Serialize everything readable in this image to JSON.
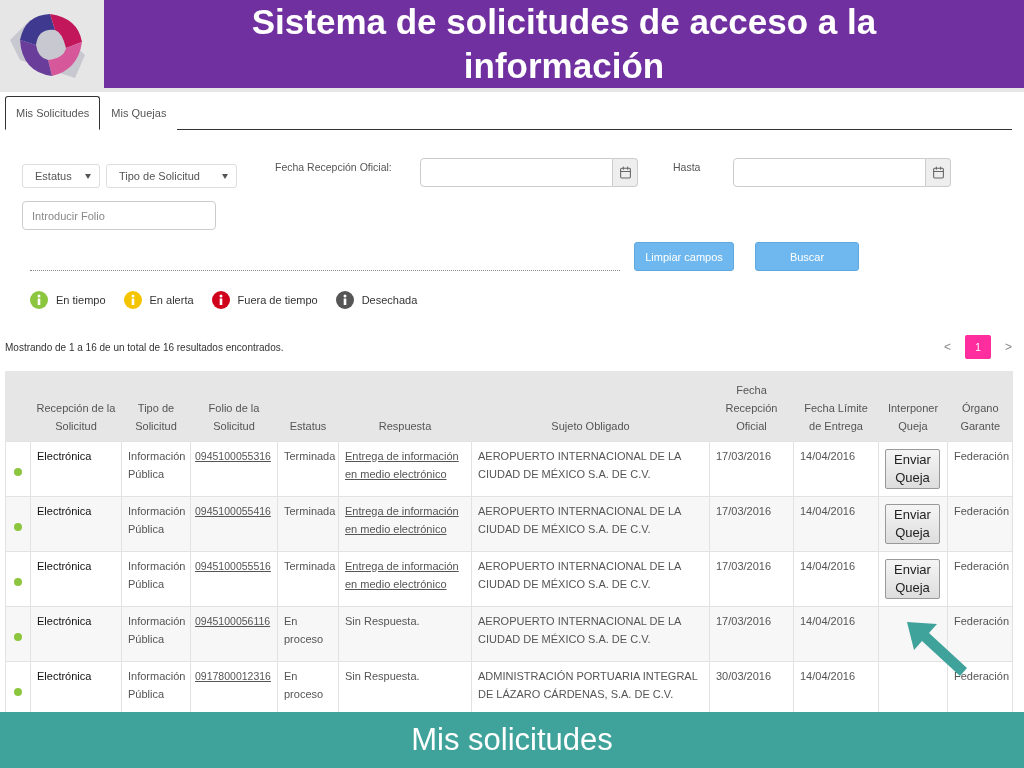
{
  "header": {
    "title": "Sistema de solicitudes de acceso a la información"
  },
  "tabs": [
    {
      "label": "Mis Solicitudes",
      "selected": true
    },
    {
      "label": "Mis Quejas",
      "selected": false
    }
  ],
  "filters": {
    "selects": [
      "Estatus",
      "Tipo de Solicitud"
    ],
    "date_from": {
      "label": "Fecha Recepción Oficial:"
    },
    "date_to": {
      "label": "Hasta"
    },
    "folio": {
      "placeholder": "Introducir Folio"
    }
  },
  "buttons": [
    "Limpiar campos",
    "Buscar"
  ],
  "legend": [
    {
      "label": "En tiempo",
      "color": "#8cc63f"
    },
    {
      "label": "En alerta",
      "color": "#f5c400"
    },
    {
      "label": "Fuera de tiempo",
      "color": "#d0021b"
    },
    {
      "label": "Desechada",
      "color": "#555555"
    }
  ],
  "results_text": "Mostrando de 1 a 16 de un total de 16 resultados encontrados.",
  "pagination": {
    "prev": "<",
    "pages": [
      {
        "label": "1",
        "selected": true
      }
    ],
    "next": ">"
  },
  "table": {
    "columns": [
      "Recepción de la Solicitud",
      "Tipo de Solicitud",
      "Folio de la Solicitud",
      "Estatus",
      "Respuesta",
      "Sujeto Obligado",
      "Fecha Recepción Oficial",
      "Fecha Límite de Entrega",
      "Interponer Queja",
      "Órgano Garante"
    ],
    "rows": [
      {
        "color": "#8cc63f",
        "reception": "Electrónica",
        "type": "Información Pública",
        "folio": "0945100055316",
        "status": "Terminada",
        "response": {
          "kind": "link",
          "text": "Entrega de información en medio electrónico"
        },
        "subject": "AEROPUERTO INTERNACIONAL DE LA CIUDAD DE MÉXICO S.A. DE C.V.",
        "received": "17/03/2016",
        "deadline": "14/04/2016",
        "complaint": "Enviar Queja",
        "body": "Federación"
      },
      {
        "color": "#8cc63f",
        "reception": "Electrónica",
        "type": "Información Pública",
        "folio": "0945100055416",
        "status": "Terminada",
        "response": {
          "kind": "link",
          "text": "Entrega de información en medio electrónico"
        },
        "subject": "AEROPUERTO INTERNACIONAL DE LA CIUDAD DE MÉXICO S.A. DE C.V.",
        "received": "17/03/2016",
        "deadline": "14/04/2016",
        "complaint": "Enviar Queja",
        "body": "Federación"
      },
      {
        "color": "#8cc63f",
        "reception": "Electrónica",
        "type": "Información Pública",
        "folio": "0945100055516",
        "status": "Terminada",
        "response": {
          "kind": "link",
          "text": "Entrega de información en medio electrónico"
        },
        "subject": "AEROPUERTO INTERNACIONAL DE LA CIUDAD DE MÉXICO S.A. DE C.V.",
        "received": "17/03/2016",
        "deadline": "14/04/2016",
        "complaint": "Enviar Queja",
        "body": "Federación"
      },
      {
        "color": "#8cc63f",
        "reception": "Electrónica",
        "type": "Información Pública",
        "folio": "0945100056116",
        "status": "En proceso",
        "response": {
          "kind": "text",
          "text": "Sin Respuesta."
        },
        "subject": "AEROPUERTO INTERNACIONAL DE LA CIUDAD DE MÉXICO S.A. DE C.V.",
        "received": "17/03/2016",
        "deadline": "14/04/2016",
        "body": "Federación"
      },
      {
        "color": "#8cc63f",
        "reception": "Electrónica",
        "type": "Información Pública",
        "folio": "0917800012316",
        "status": "En proceso",
        "response": {
          "kind": "text",
          "text": "Sin Respuesta."
        },
        "subject": "ADMINISTRACIÓN PORTUARIA INTEGRAL DE LÁZARO CÁRDENAS, S.A. DE C.V.",
        "received": "30/03/2016",
        "deadline": "14/04/2016",
        "body": "Federación"
      }
    ]
  },
  "banner": {
    "text": "Mis solicitudes"
  }
}
